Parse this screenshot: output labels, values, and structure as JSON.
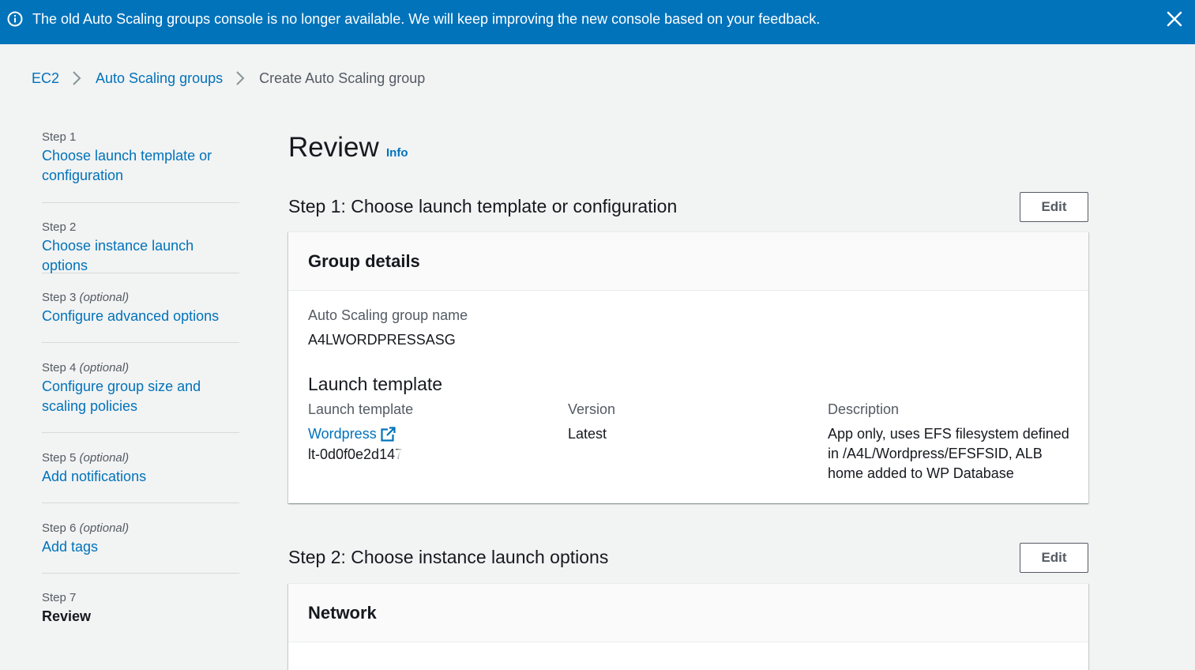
{
  "banner": {
    "message": "The old Auto Scaling groups console is no longer available. We will keep improving the new console based on your feedback.",
    "color": "#0073bb",
    "info_icon": "info-circle-icon",
    "close_icon": "close-icon"
  },
  "breadcrumb": [
    {
      "label": "EC2"
    },
    {
      "label": "Auto Scaling groups"
    },
    {
      "label": "Create Auto Scaling group"
    }
  ],
  "sidenav": {
    "steps": [
      {
        "step": "Step 1",
        "optional": "",
        "label": "Choose launch template or configuration"
      },
      {
        "step": "Step 2",
        "optional": "",
        "label": "Choose instance launch options"
      },
      {
        "step": "Step 3",
        "optional": "(optional)",
        "label": "Configure advanced options"
      },
      {
        "step": "Step 4",
        "optional": "(optional)",
        "label": "Configure group size and scaling policies"
      },
      {
        "step": "Step 5",
        "optional": "(optional)",
        "label": "Add notifications"
      },
      {
        "step": "Step 6",
        "optional": "(optional)",
        "label": "Add tags"
      },
      {
        "step": "Step 7",
        "optional": "",
        "label": "Review"
      }
    ]
  },
  "main": {
    "title": "Review",
    "info_link": "Info",
    "section1": {
      "heading": "Step 1: Choose launch template or configuration",
      "edit_label": "Edit",
      "panel_title": "Group details",
      "asg_name_label": "Auto Scaling group name",
      "asg_name_value": "A4LWORDPRESSASG",
      "launch_template_heading": "Launch template",
      "col_template_label": "Launch template",
      "col_version_label": "Version",
      "col_description_label": "Description",
      "template_name": "Wordpress",
      "template_id": "lt-0d0f0e2d147",
      "version_value": "Latest",
      "description_value": "App only, uses EFS filesystem defined in /A4L/Wordpress/EFSFSID, ALB home added to WP Database"
    },
    "section2": {
      "heading": "Step 2: Choose instance launch options",
      "edit_label": "Edit",
      "panel_title": "Network"
    }
  }
}
